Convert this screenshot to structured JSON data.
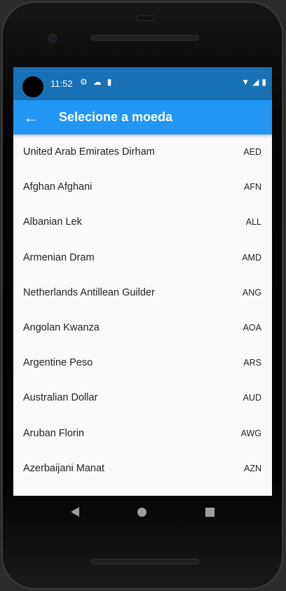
{
  "status_bar": {
    "time": "11:52",
    "left_icons": [
      "gear-icon",
      "cloud-icon",
      "sd-card-icon"
    ],
    "right_icons": [
      "wifi-icon",
      "signal-icon",
      "battery-icon"
    ]
  },
  "app_bar": {
    "title": "Selecione a moeda",
    "back_icon": "arrow-back-icon",
    "color": "#2196f3"
  },
  "currencies": [
    {
      "name": "United Arab Emirates Dirham",
      "code": "AED"
    },
    {
      "name": "Afghan Afghani",
      "code": "AFN"
    },
    {
      "name": "Albanian Lek",
      "code": "ALL"
    },
    {
      "name": "Armenian Dram",
      "code": "AMD"
    },
    {
      "name": "Netherlands Antillean Guilder",
      "code": "ANG"
    },
    {
      "name": "Angolan Kwanza",
      "code": "AOA"
    },
    {
      "name": "Argentine Peso",
      "code": "ARS"
    },
    {
      "name": "Australian Dollar",
      "code": "AUD"
    },
    {
      "name": "Aruban Florin",
      "code": "AWG"
    },
    {
      "name": "Azerbaijani Manat",
      "code": "AZN"
    }
  ],
  "nav_bar": [
    "back-icon",
    "home-icon",
    "recents-icon"
  ]
}
